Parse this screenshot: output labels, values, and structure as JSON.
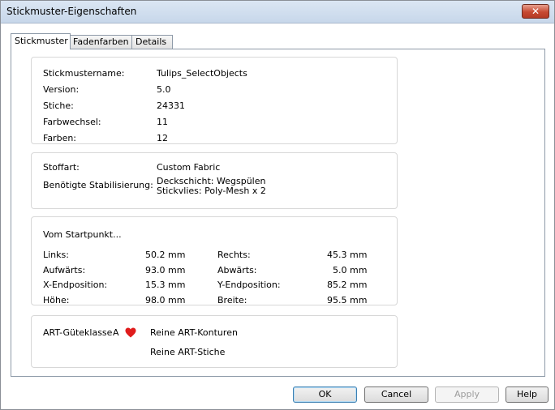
{
  "window": {
    "title": "Stickmuster-Eigenschaften",
    "close_label": "✕"
  },
  "tabs": [
    {
      "label": "Stickmuster",
      "active": true
    },
    {
      "label": "Fadenfarben",
      "active": false
    },
    {
      "label": "Details",
      "active": false
    }
  ],
  "general": {
    "name_label": "Stickmustername:",
    "name_value": "Tulips_SelectObjects",
    "version_label": "Version:",
    "version_value": "5.0",
    "stitches_label": "Stiche:",
    "stitches_value": "24331",
    "color_changes_label": "Farbwechsel:",
    "color_changes_value": "11",
    "colors_label": "Farben:",
    "colors_value": "12"
  },
  "fabric": {
    "fabric_label": "Stoffart:",
    "fabric_value": "Custom Fabric",
    "stabilization_label": "Benötigte Stabilisierung:",
    "stabilization_line1": "Deckschicht: Wegspülen",
    "stabilization_line2": "Stickvlies: Poly-Mesh x 2"
  },
  "start": {
    "heading": "Vom Startpunkt...",
    "left_label": "Links:",
    "left_value": "50.2 mm",
    "right_label": "Rechts:",
    "right_value": "45.3 mm",
    "up_label": "Aufwärts:",
    "up_value": "93.0 mm",
    "down_label": "Abwärts:",
    "down_value": "5.0 mm",
    "x_end_label": "X-Endposition:",
    "x_end_value": "15.3 mm",
    "y_end_label": "Y-Endposition:",
    "y_end_value": "85.2 mm",
    "height_label": "Höhe:",
    "height_value": "98.0 mm",
    "width_label": "Breite:",
    "width_value": "95.5 mm"
  },
  "art": {
    "quality_label": "ART-Güteklasse",
    "quality_grade": "A",
    "heart_color": "#e01c1c",
    "outlines_text": "Reine ART-Konturen",
    "stitches_text": "Reine ART-Stiche"
  },
  "buttons": {
    "ok": "OK",
    "cancel": "Cancel",
    "apply": "Apply",
    "help": "Help"
  }
}
